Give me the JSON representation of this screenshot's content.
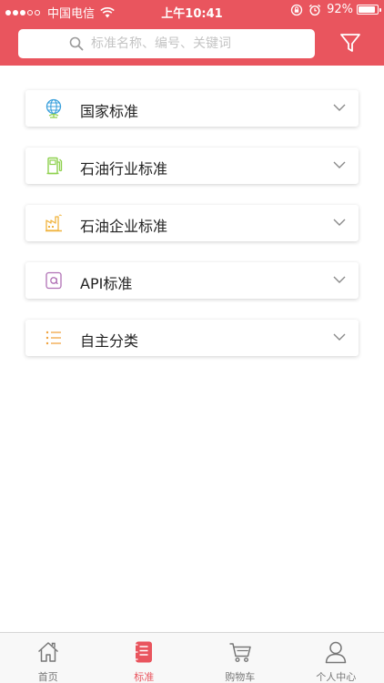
{
  "status_bar": {
    "carrier": "中国电信",
    "time": "上午10:41",
    "battery": "92%",
    "battery_level": 0.92
  },
  "search": {
    "placeholder": "标准名称、编号、关键词",
    "value": ""
  },
  "categories": [
    {
      "label": "国家标准",
      "icon": "globe-icon",
      "color": "#3aa0dc"
    },
    {
      "label": "石油行业标准",
      "icon": "fuel-pump-icon",
      "color": "#8fd14f"
    },
    {
      "label": "石油企业标准",
      "icon": "factory-icon",
      "color": "#f0b33e"
    },
    {
      "label": "API标准",
      "icon": "api-letter-icon",
      "color": "#b071b5"
    },
    {
      "label": "自主分类",
      "icon": "list-icon",
      "color": "#f0a23e"
    }
  ],
  "tabbar": {
    "tabs": [
      {
        "label": "首页",
        "icon": "home-icon",
        "active": false
      },
      {
        "label": "标准",
        "icon": "book-icon",
        "active": true
      },
      {
        "label": "购物车",
        "icon": "cart-icon",
        "active": false
      },
      {
        "label": "个人中心",
        "icon": "user-icon",
        "active": false
      }
    ]
  },
  "colors": {
    "brand": "#e9555e",
    "tab_inactive": "#777777"
  }
}
